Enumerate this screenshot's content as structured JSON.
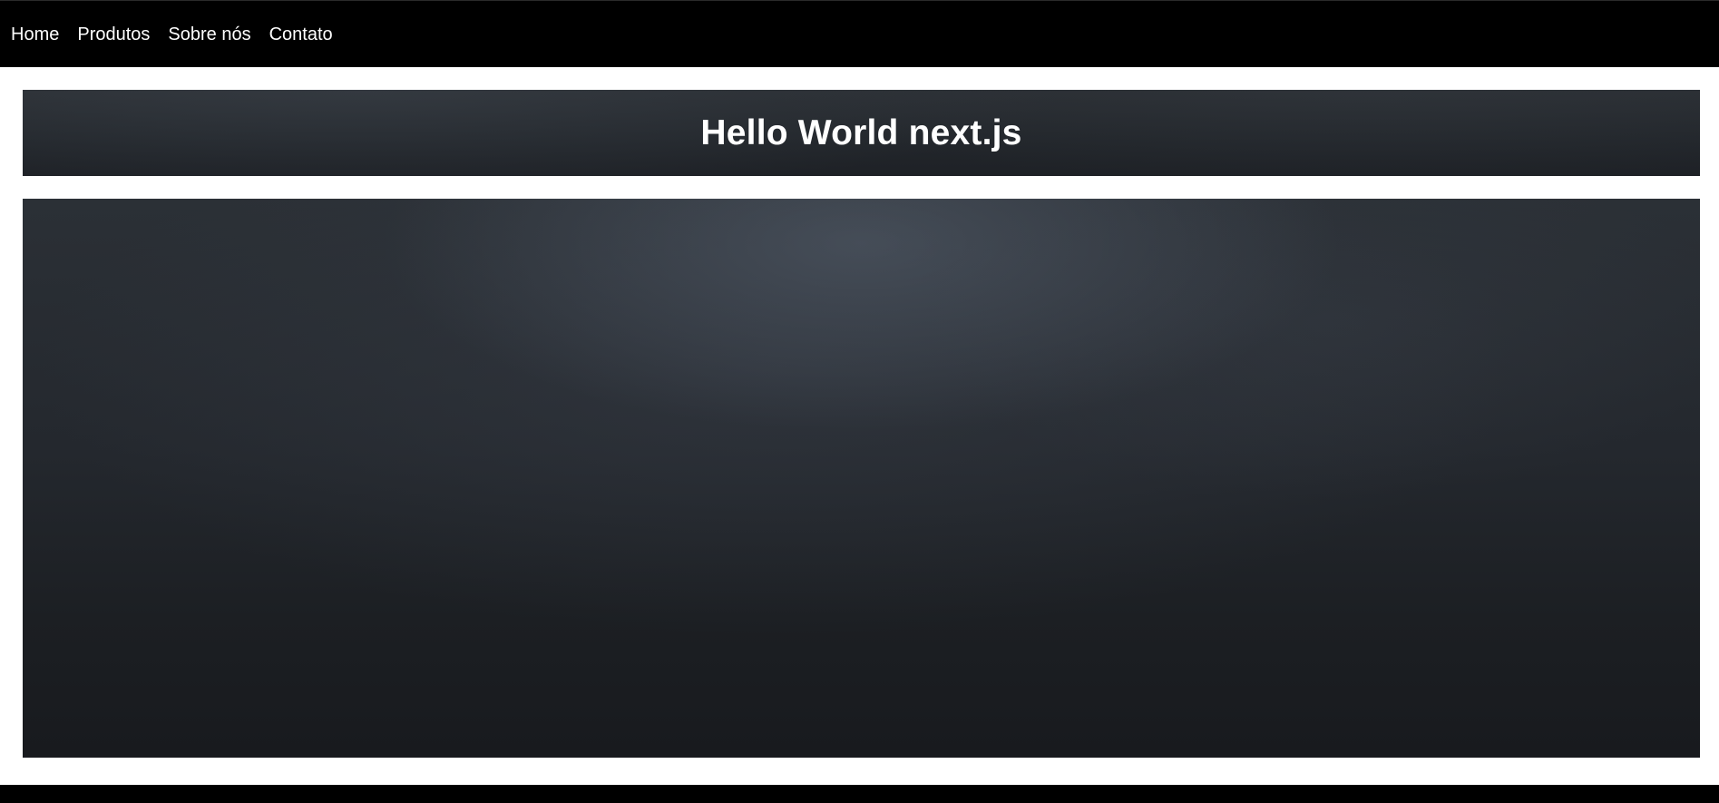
{
  "nav": {
    "links": [
      {
        "label": "Home"
      },
      {
        "label": "Produtos"
      },
      {
        "label": "Sobre nós"
      },
      {
        "label": "Contato"
      }
    ]
  },
  "banner": {
    "title": "Hello World next.js"
  },
  "colors": {
    "navbar_bg": "#000000",
    "page_bg": "#ffffff",
    "panel_dark": "#22262b",
    "text": "#ffffff"
  }
}
